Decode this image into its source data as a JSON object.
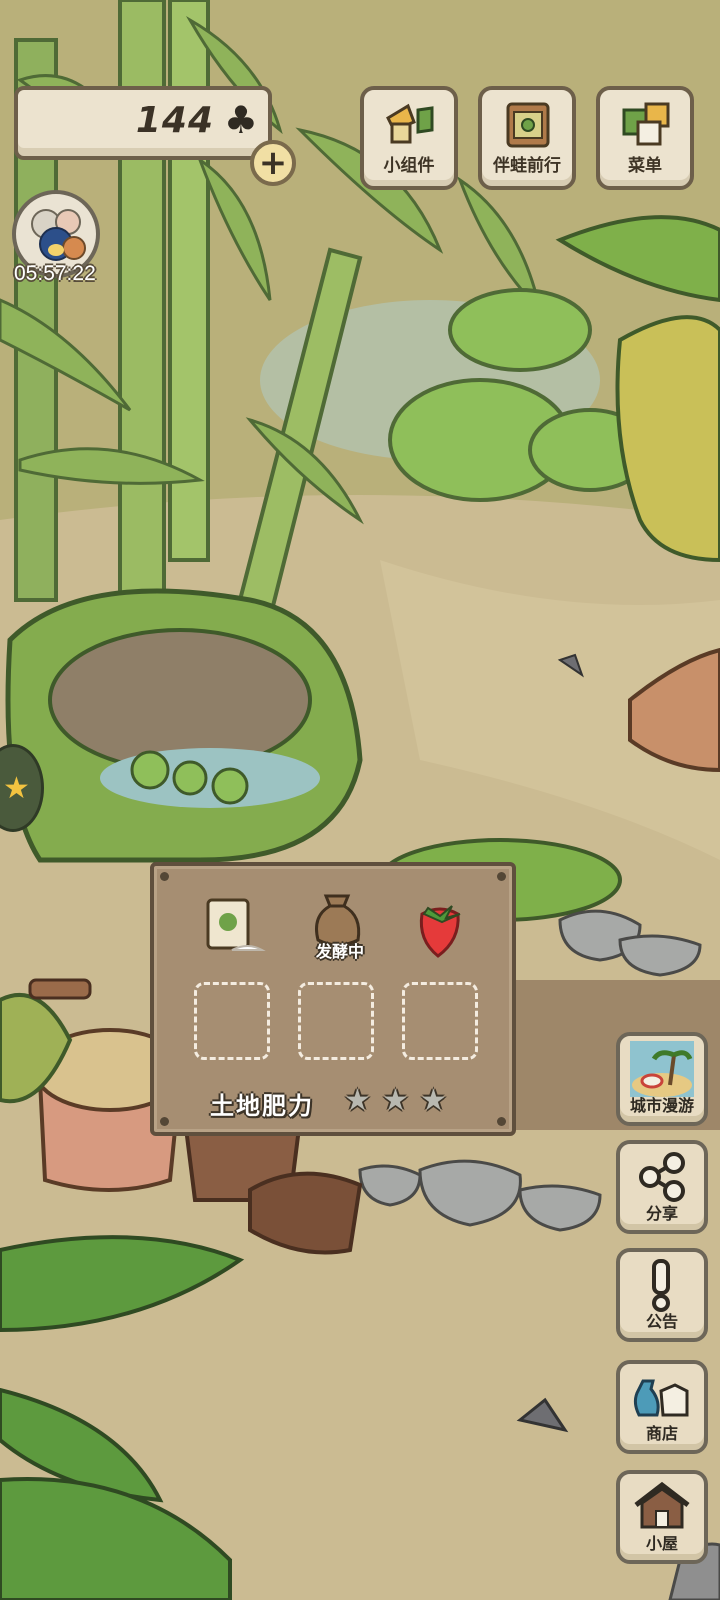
{
  "currency": {
    "amount": "144",
    "icon": "clover-icon"
  },
  "visitor": {
    "timer": "05:57:22"
  },
  "top_buttons": [
    {
      "label": "小组件",
      "icon": "widget-icon"
    },
    {
      "label": "伴蛙前行",
      "icon": "frog-journey-icon"
    },
    {
      "label": "菜单",
      "icon": "menu-icon"
    }
  ],
  "side_buttons": [
    {
      "label": "城市漫游",
      "icon": "city-roam-icon"
    },
    {
      "label": "分享",
      "icon": "share-icon"
    },
    {
      "label": "公告",
      "icon": "notice-icon"
    },
    {
      "label": "商店",
      "icon": "shop-icon"
    },
    {
      "label": "小屋",
      "icon": "house-icon"
    }
  ],
  "garden": {
    "items": [
      {
        "icon": "seed-packet-icon",
        "status": ""
      },
      {
        "icon": "fertilizer-bag-icon",
        "status": "发酵中"
      },
      {
        "icon": "strawberry-icon",
        "status": ""
      }
    ],
    "empty_slots": 3,
    "fertility_label": "土地肥力",
    "fertility_stars": {
      "filled": 0,
      "total": 3
    }
  }
}
